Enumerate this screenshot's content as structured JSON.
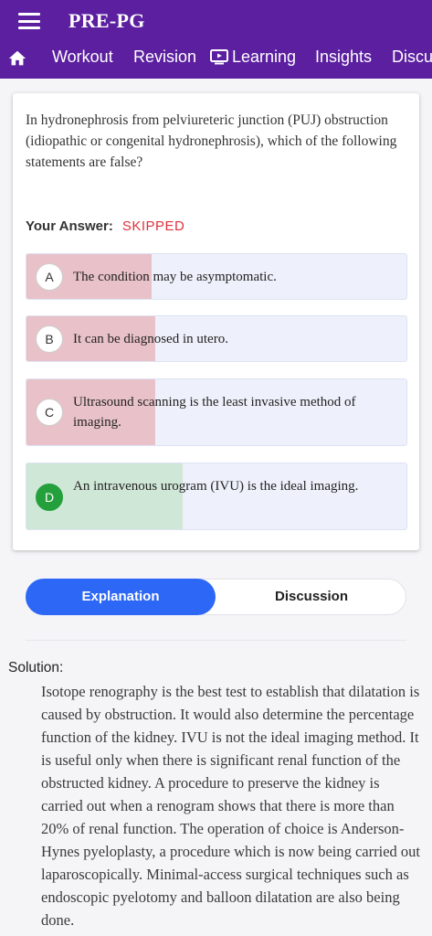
{
  "header": {
    "app_title": "PRE-PG",
    "menu_icon": "hamburger-menu-icon",
    "background_color": "#5b1fa0"
  },
  "nav": {
    "home_icon": "home-icon",
    "items": [
      {
        "label": "Workout"
      },
      {
        "label": "Revision"
      },
      {
        "label": "Learning",
        "icon": "video-play-icon"
      },
      {
        "label": "Insights"
      },
      {
        "label": "Discu"
      }
    ]
  },
  "question": {
    "text": "In hydronephrosis from pelviureteric junction (PUJ) obstruction (idiopathic or congenital hydronephrosis), which of the following statements are false?",
    "your_answer_label": "Your Answer:",
    "your_answer_status": "SKIPPED",
    "options": [
      {
        "letter": "A",
        "text": "The condition may be asymptomatic.",
        "result": "wrong",
        "percent": 33
      },
      {
        "letter": "B",
        "text": "It can be diagnosed in utero.",
        "result": "wrong",
        "percent": 34
      },
      {
        "letter": "C",
        "text": "Ultrasound scanning is the least invasive method of imaging.",
        "result": "wrong",
        "percent": 34
      },
      {
        "letter": "D",
        "text": "An intravenous urogram (IVU) is the ideal imaging.",
        "result": "correct",
        "percent": 41
      }
    ]
  },
  "tabs": {
    "explanation": "Explanation",
    "discussion": "Discussion",
    "active_color": "#2d67f6"
  },
  "solution": {
    "label": "Solution:",
    "text": "Isotope renography is the best test to establish that dilatation is caused by obstruction. It would also determine the percentage function of the kidney. IVU is not the ideal imaging method. It is useful only when there is significant renal function of the obstructed kidney. A procedure to preserve the kidney is carried out when a renogram shows that there is more than 20% of renal function. The operation of choice is Anderson-Hynes pyeloplasty, a procedure which is now being carried out laparoscopically. Minimal-access surgical techniques such as endoscopic pyelotomy and balloon dilatation are also being done."
  }
}
